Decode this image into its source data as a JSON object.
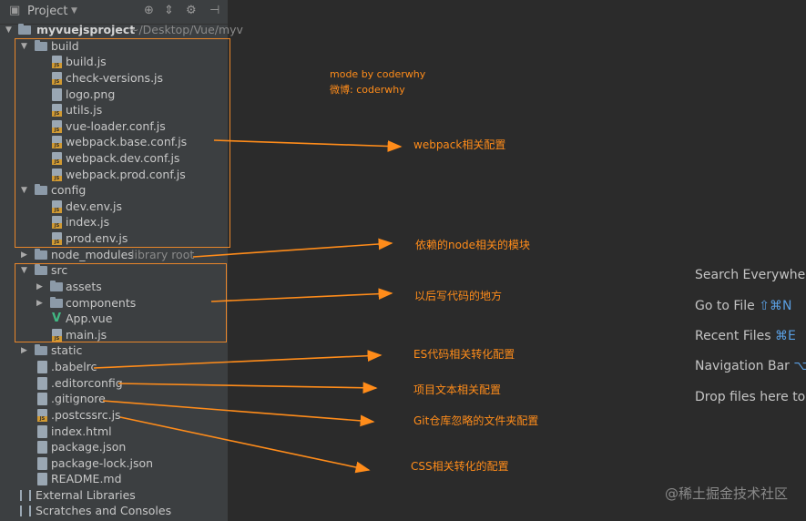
{
  "header": {
    "title": "Project",
    "dropdown_icon": "chevron-down-icon"
  },
  "tree": {
    "root": {
      "label": "myvuejsproject",
      "path": "~/Desktop/Vue/myv"
    },
    "build": {
      "label": "build",
      "files": [
        "build.js",
        "check-versions.js",
        "logo.png",
        "utils.js",
        "vue-loader.conf.js",
        "webpack.base.conf.js",
        "webpack.dev.conf.js",
        "webpack.prod.conf.js"
      ]
    },
    "config": {
      "label": "config",
      "files": [
        "dev.env.js",
        "index.js",
        "prod.env.js"
      ]
    },
    "node_modules": {
      "label": "node_modules",
      "suffix": "library root"
    },
    "src": {
      "label": "src",
      "assets": "assets",
      "components": "components",
      "app": "App.vue",
      "main": "main.js"
    },
    "static": "static",
    "root_files": [
      ".babelrc",
      ".editorconfig",
      ".gitignore",
      ".postcssrc.js",
      "index.html",
      "package.json",
      "package-lock.json",
      "README.md"
    ],
    "external": "External Libraries",
    "scratches": "Scratches and Consoles"
  },
  "credit": {
    "line1": "mode by coderwhy",
    "line2": "微博: coderwhy"
  },
  "annotations": {
    "webpack": "webpack相关配置",
    "node": "依赖的node相关的模块",
    "src": "以后写代码的地方",
    "babel": "ES代码相关转化配置",
    "editor": "项目文本相关配置",
    "git": "Git仓库忽略的文件夹配置",
    "css": "CSS相关转化的配置"
  },
  "hints": {
    "search": "Search Everywhe",
    "goto": "Go to File",
    "goto_key": "⇧⌘N",
    "recent": "Recent Files",
    "recent_key": "⌘E",
    "nav": "Navigation Bar",
    "nav_key": "⌥",
    "drop": "Drop files here to"
  },
  "watermark": "@稀土掘金技术社区",
  "colors": {
    "annotation": "#ff8c1a",
    "sidebar": "#3c3f41",
    "editor": "#2b2b2b",
    "shortcut": "#5a9fe2"
  }
}
